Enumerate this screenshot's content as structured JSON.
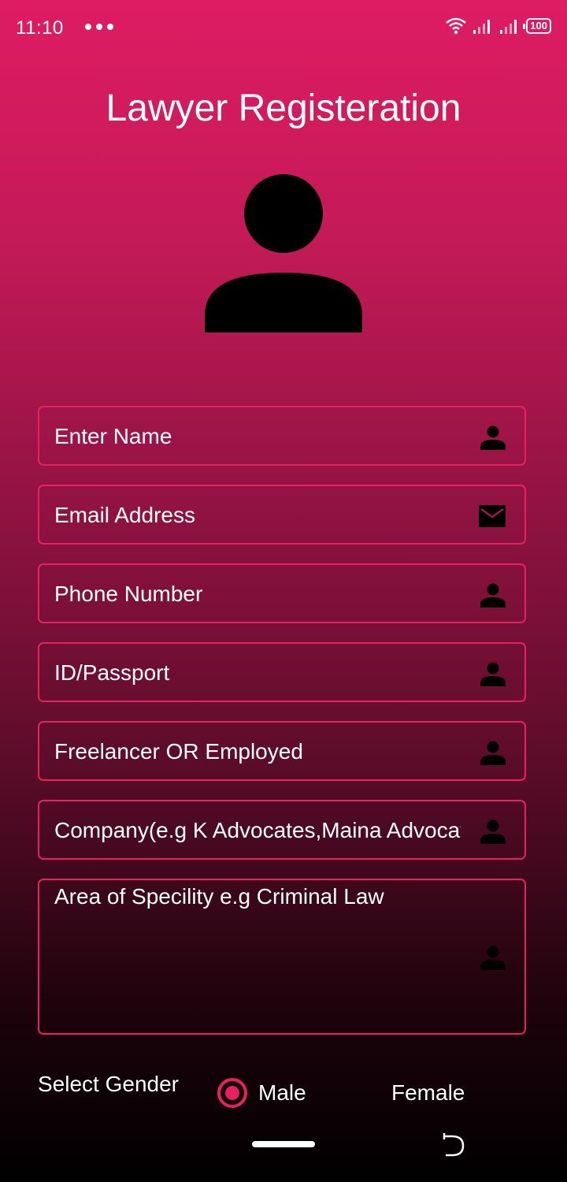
{
  "status_bar": {
    "time": "11:10",
    "battery": "100"
  },
  "title": "Lawyer Registeration",
  "fields": {
    "name": "Enter Name",
    "email": "Email Address",
    "phone": "Phone Number",
    "id_passport": "ID/Passport",
    "employment": "Freelancer OR Employed",
    "company": "Company(e.g K Advocates,Maina Advocates)",
    "specialty": "Area of Specility e.g Criminal Law"
  },
  "gender": {
    "label": "Select Gender",
    "options": [
      "Male",
      "Female"
    ],
    "selected": "Male"
  },
  "colors": {
    "accent": "#e8205f",
    "gradient_top": "#de1c63",
    "gradient_bottom": "#000000"
  }
}
